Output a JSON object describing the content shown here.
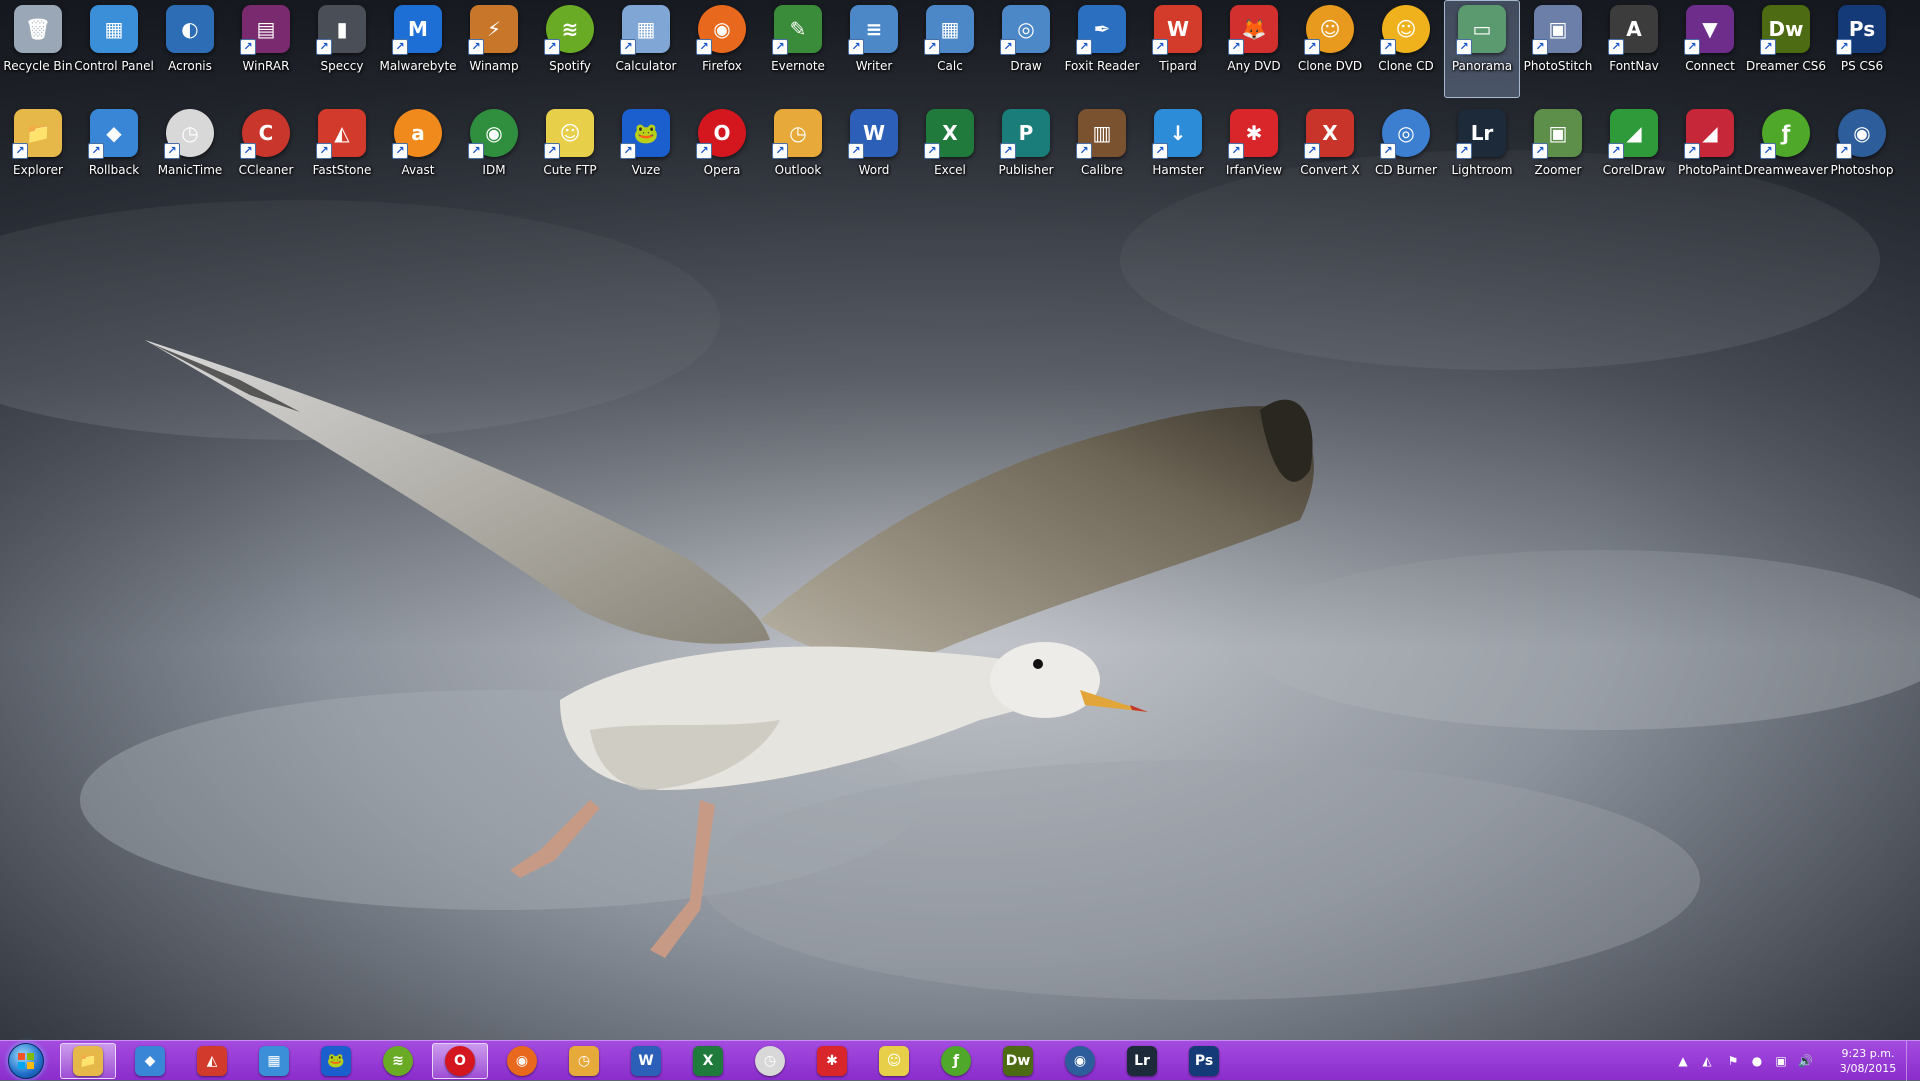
{
  "desktop": {
    "row1": [
      {
        "label": "Recycle Bin",
        "icon": "recycle-bin-icon",
        "glyph": "🗑",
        "color": "#9aa7b6",
        "shortcut": false
      },
      {
        "label": "Control Panel",
        "icon": "control-panel-icon",
        "glyph": "▦",
        "color": "#3a8fd8",
        "shortcut": false
      },
      {
        "label": "Acronis",
        "icon": "acronis-icon",
        "glyph": "◐",
        "color": "#2d6db5",
        "shortcut": false
      },
      {
        "label": "WinRAR",
        "icon": "winrar-icon",
        "glyph": "▤",
        "color": "#7a2a6e",
        "shortcut": true
      },
      {
        "label": "Speccy",
        "icon": "speccy-icon",
        "glyph": "▮",
        "color": "#4a4f57",
        "shortcut": true
      },
      {
        "label": "Malwarebyte",
        "icon": "malwarebytes-icon",
        "glyph": "M",
        "color": "#1d6fd6",
        "shortcut": true
      },
      {
        "label": "Winamp",
        "icon": "winamp-icon",
        "glyph": "⚡",
        "color": "#c8762a",
        "shortcut": true
      },
      {
        "label": "Spotify",
        "icon": "spotify-icon",
        "glyph": "≋",
        "color": "#6aab25",
        "shortcut": true,
        "round": true
      },
      {
        "label": "Calculator",
        "icon": "calculator-icon",
        "glyph": "▦",
        "color": "#7fa6d4",
        "shortcut": true
      },
      {
        "label": "Firefox",
        "icon": "firefox-icon",
        "glyph": "◉",
        "color": "#e8681d",
        "shortcut": true,
        "round": true
      },
      {
        "label": "Evernote",
        "icon": "evernote-icon",
        "glyph": "✎",
        "color": "#3b8c3a",
        "shortcut": true
      },
      {
        "label": "Writer",
        "icon": "writer-icon",
        "glyph": "≡",
        "color": "#4c88c8",
        "shortcut": true
      },
      {
        "label": "Calc",
        "icon": "calc-icon",
        "glyph": "▦",
        "color": "#4c88c8",
        "shortcut": true
      },
      {
        "label": "Draw",
        "icon": "draw-icon",
        "glyph": "◎",
        "color": "#4c88c8",
        "shortcut": true
      },
      {
        "label": "Foxit Reader",
        "icon": "foxit-reader-icon",
        "glyph": "✒",
        "color": "#2b6fc0",
        "shortcut": true
      },
      {
        "label": "Tipard",
        "icon": "tipard-icon",
        "glyph": "W",
        "color": "#d33b2a",
        "shortcut": true
      },
      {
        "label": "Any DVD",
        "icon": "any-dvd-icon",
        "glyph": "🦊",
        "color": "#d22f2f",
        "shortcut": true
      },
      {
        "label": "Clone DVD",
        "icon": "clone-dvd-icon",
        "glyph": "☺",
        "color": "#e79a1d",
        "shortcut": true,
        "round": true
      },
      {
        "label": "Clone CD",
        "icon": "clone-cd-icon",
        "glyph": "☺",
        "color": "#f0b21c",
        "shortcut": true,
        "round": true
      },
      {
        "label": "Panorama",
        "icon": "panorama-icon",
        "glyph": "▭",
        "color": "#5a9a6e",
        "shortcut": true,
        "selected": true
      },
      {
        "label": "PhotoStitch",
        "icon": "photostitch-icon",
        "glyph": "▣",
        "color": "#6c7fa8",
        "shortcut": true
      },
      {
        "label": "FontNav",
        "icon": "fontnav-icon",
        "glyph": "A",
        "color": "#3c3c3c",
        "shortcut": true
      },
      {
        "label": "Connect",
        "icon": "connect-icon",
        "glyph": "▼",
        "color": "#6e2d8a",
        "shortcut": true
      },
      {
        "label": "Dreamer CS6",
        "icon": "dreamweaver-cs6-icon",
        "glyph": "Dw",
        "color": "#4d6b12",
        "shortcut": true
      },
      {
        "label": "PS CS6",
        "icon": "photoshop-cs6-icon",
        "glyph": "Ps",
        "color": "#143a78",
        "shortcut": true
      }
    ],
    "row2": [
      {
        "label": "Explorer",
        "icon": "explorer-icon",
        "glyph": "📁",
        "color": "#e6b84a",
        "shortcut": true
      },
      {
        "label": "Rollback",
        "icon": "rollback-icon",
        "glyph": "◆",
        "color": "#3a86d6",
        "shortcut": true
      },
      {
        "label": "ManicTime",
        "icon": "manictime-icon",
        "glyph": "◷",
        "color": "#d8d8d8",
        "shortcut": true,
        "round": true
      },
      {
        "label": "CCleaner",
        "icon": "ccleaner-icon",
        "glyph": "C",
        "color": "#c9362b",
        "shortcut": true,
        "round": true
      },
      {
        "label": "FastStone",
        "icon": "faststone-icon",
        "glyph": "◭",
        "color": "#d23b2b",
        "shortcut": true
      },
      {
        "label": "Avast",
        "icon": "avast-icon",
        "glyph": "a",
        "color": "#f08a1c",
        "shortcut": true,
        "round": true
      },
      {
        "label": "IDM",
        "icon": "idm-icon",
        "glyph": "◉",
        "color": "#2f8f3f",
        "shortcut": true,
        "round": true
      },
      {
        "label": "Cute FTP",
        "icon": "cute-ftp-icon",
        "glyph": "☺",
        "color": "#e8cf4a",
        "shortcut": true
      },
      {
        "label": "Vuze",
        "icon": "vuze-icon",
        "glyph": "🐸",
        "color": "#1b5fcf",
        "shortcut": true
      },
      {
        "label": "Opera",
        "icon": "opera-icon",
        "glyph": "O",
        "color": "#d4171e",
        "shortcut": true,
        "round": true
      },
      {
        "label": "Outlook",
        "icon": "outlook-icon",
        "glyph": "◷",
        "color": "#e6a93a",
        "shortcut": true
      },
      {
        "label": "Word",
        "icon": "word-icon",
        "glyph": "W",
        "color": "#2b5fb8",
        "shortcut": true
      },
      {
        "label": "Excel",
        "icon": "excel-icon",
        "glyph": "X",
        "color": "#1f7a3c",
        "shortcut": true
      },
      {
        "label": "Publisher",
        "icon": "publisher-icon",
        "glyph": "P",
        "color": "#1a7d7a",
        "shortcut": true
      },
      {
        "label": "Calibre",
        "icon": "calibre-icon",
        "glyph": "▥",
        "color": "#7a5230",
        "shortcut": true
      },
      {
        "label": "Hamster",
        "icon": "hamster-icon",
        "glyph": "↓",
        "color": "#2d8cd8",
        "shortcut": true
      },
      {
        "label": "IrfanView",
        "icon": "irfanview-icon",
        "glyph": "✱",
        "color": "#d8262a",
        "shortcut": true
      },
      {
        "label": "Convert X",
        "icon": "convert-x-icon",
        "glyph": "X",
        "color": "#c8332a",
        "shortcut": true
      },
      {
        "label": "CD Burner",
        "icon": "cd-burner-icon",
        "glyph": "◎",
        "color": "#3c7fd0",
        "shortcut": true,
        "round": true
      },
      {
        "label": "Lightroom",
        "icon": "lightroom-icon",
        "glyph": "Lr",
        "color": "#1c2a3a",
        "shortcut": true
      },
      {
        "label": "Zoomer",
        "icon": "zoomer-icon",
        "glyph": "▣",
        "color": "#5e8f4a",
        "shortcut": true
      },
      {
        "label": "CorelDraw",
        "icon": "coreldraw-icon",
        "glyph": "◢",
        "color": "#2f9a3a",
        "shortcut": true
      },
      {
        "label": "PhotoPaint",
        "icon": "photopaint-icon",
        "glyph": "◢",
        "color": "#c6283a",
        "shortcut": true
      },
      {
        "label": "Dreamweaver",
        "icon": "dreamweaver-icon",
        "glyph": "ƒ",
        "color": "#4fa82a",
        "shortcut": true,
        "round": true
      },
      {
        "label": "Photoshop",
        "icon": "photoshop-icon",
        "glyph": "◉",
        "color": "#2d5d9a",
        "shortcut": true,
        "round": true
      }
    ]
  },
  "taskbar": {
    "items": [
      {
        "icon": "windows-explorer-icon",
        "glyph": "📁",
        "color": "#e6b84a",
        "active": true
      },
      {
        "icon": "rollback-icon",
        "glyph": "◆",
        "color": "#3a86d6"
      },
      {
        "icon": "faststone-icon",
        "glyph": "◭",
        "color": "#d23b2b"
      },
      {
        "icon": "control-panel-icon",
        "glyph": "▦",
        "color": "#3a8fd8"
      },
      {
        "icon": "vuze-icon",
        "glyph": "🐸",
        "color": "#1b5fcf"
      },
      {
        "icon": "spotify-icon",
        "glyph": "≋",
        "color": "#6aab25",
        "round": true
      },
      {
        "icon": "opera-icon",
        "glyph": "O",
        "color": "#d4171e",
        "round": true,
        "active": true
      },
      {
        "icon": "firefox-icon",
        "glyph": "◉",
        "color": "#e8681d",
        "round": true
      },
      {
        "icon": "outlook-icon",
        "glyph": "◷",
        "color": "#e6a93a"
      },
      {
        "icon": "word-icon",
        "glyph": "W",
        "color": "#2b5fb8"
      },
      {
        "icon": "excel-icon",
        "glyph": "X",
        "color": "#1f7a3c"
      },
      {
        "icon": "manictime-icon",
        "glyph": "◷",
        "color": "#d8d8d8",
        "round": true
      },
      {
        "icon": "irfanview-icon",
        "glyph": "✱",
        "color": "#d8262a"
      },
      {
        "icon": "cute-ftp-icon",
        "glyph": "☺",
        "color": "#e8cf4a"
      },
      {
        "icon": "dreamweaver-icon",
        "glyph": "ƒ",
        "color": "#4fa82a",
        "round": true
      },
      {
        "icon": "dreamweaver-cs6-icon",
        "glyph": "Dw",
        "color": "#4d6b12"
      },
      {
        "icon": "photoshop-icon",
        "glyph": "◉",
        "color": "#2d5d9a",
        "round": true
      },
      {
        "icon": "lightroom-icon",
        "glyph": "Lr",
        "color": "#1c2a3a"
      },
      {
        "icon": "photoshop-cs6-icon",
        "glyph": "Ps",
        "color": "#143a78"
      }
    ],
    "tray": {
      "icons": [
        {
          "icon": "chevron-up-icon",
          "glyph": "▲"
        },
        {
          "icon": "adobe-tray-icon",
          "glyph": "◭"
        },
        {
          "icon": "action-center-flag-icon",
          "glyph": "⚑"
        },
        {
          "icon": "avast-tray-icon",
          "glyph": "●"
        },
        {
          "icon": "network-icon",
          "glyph": "▣"
        },
        {
          "icon": "volume-icon",
          "glyph": "🔊"
        }
      ],
      "clock_time": "9:23 p.m.",
      "clock_date": "3/08/2015"
    }
  }
}
